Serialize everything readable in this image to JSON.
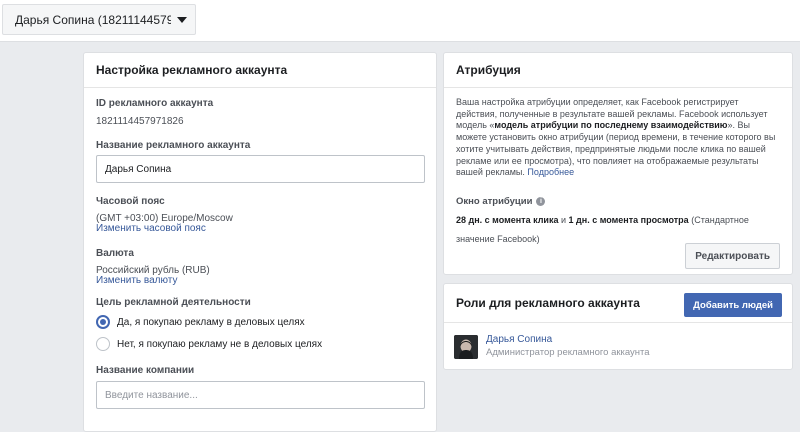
{
  "account_selector": {
    "label": "Дарья Сопина (18211144579..."
  },
  "settings": {
    "title": "Настройка рекламного аккаунта",
    "account_id_label": "ID рекламного аккаунта",
    "account_id_value": "1821114457971826",
    "account_name_label": "Название рекламного аккаунта",
    "account_name_value": "Дарья Сопина",
    "timezone_label": "Часовой пояс",
    "timezone_value": "(GMT +03:00) Europe/Moscow",
    "timezone_link": "Изменить часовой пояс",
    "currency_label": "Валюта",
    "currency_value": "Российский рубль (RUB)",
    "currency_link": "Изменить валюту",
    "purpose_label": "Цель рекламной деятельности",
    "purpose_options": [
      {
        "label": "Да, я покупаю рекламу в деловых целях",
        "checked": true
      },
      {
        "label": "Нет, я покупаю рекламу не в деловых целях",
        "checked": false
      }
    ],
    "company_label": "Название компании",
    "company_placeholder": "Введите название..."
  },
  "attribution": {
    "title": "Атрибуция",
    "desc_1": "Ваша настройка атрибуции определяет, как Facebook регистрирует действия, полученные в результате вашей рекламы. Facebook использует модель «",
    "desc_bold": "модель атрибуции по последнему взаимодействию",
    "desc_2": "». Вы можете установить окно атрибуции (период времени, в течение которого вы хотите учитывать действия, предпринятые людьми после клика по вашей рекламе или ее просмотра), что повлияет на отображаемые результаты вашей рекламы.",
    "more_link": "Подробнее",
    "window_label": "Окно атрибуции",
    "window_bold_1": "28 дн. с момента клика",
    "window_mid": "и",
    "window_bold_2": "1 дн. с момента просмотра",
    "window_rest": "(Стандартное значение Facebook)",
    "edit_button": "Редактировать"
  },
  "roles": {
    "title": "Роли для рекламного аккаунта",
    "add_button": "Добавить людей",
    "member_name": "Дарья Сопина",
    "member_role": "Администратор рекламного аккаунта"
  },
  "colors": {
    "accent": "#4267b2",
    "link": "#365899",
    "background": "#e9ebee"
  }
}
